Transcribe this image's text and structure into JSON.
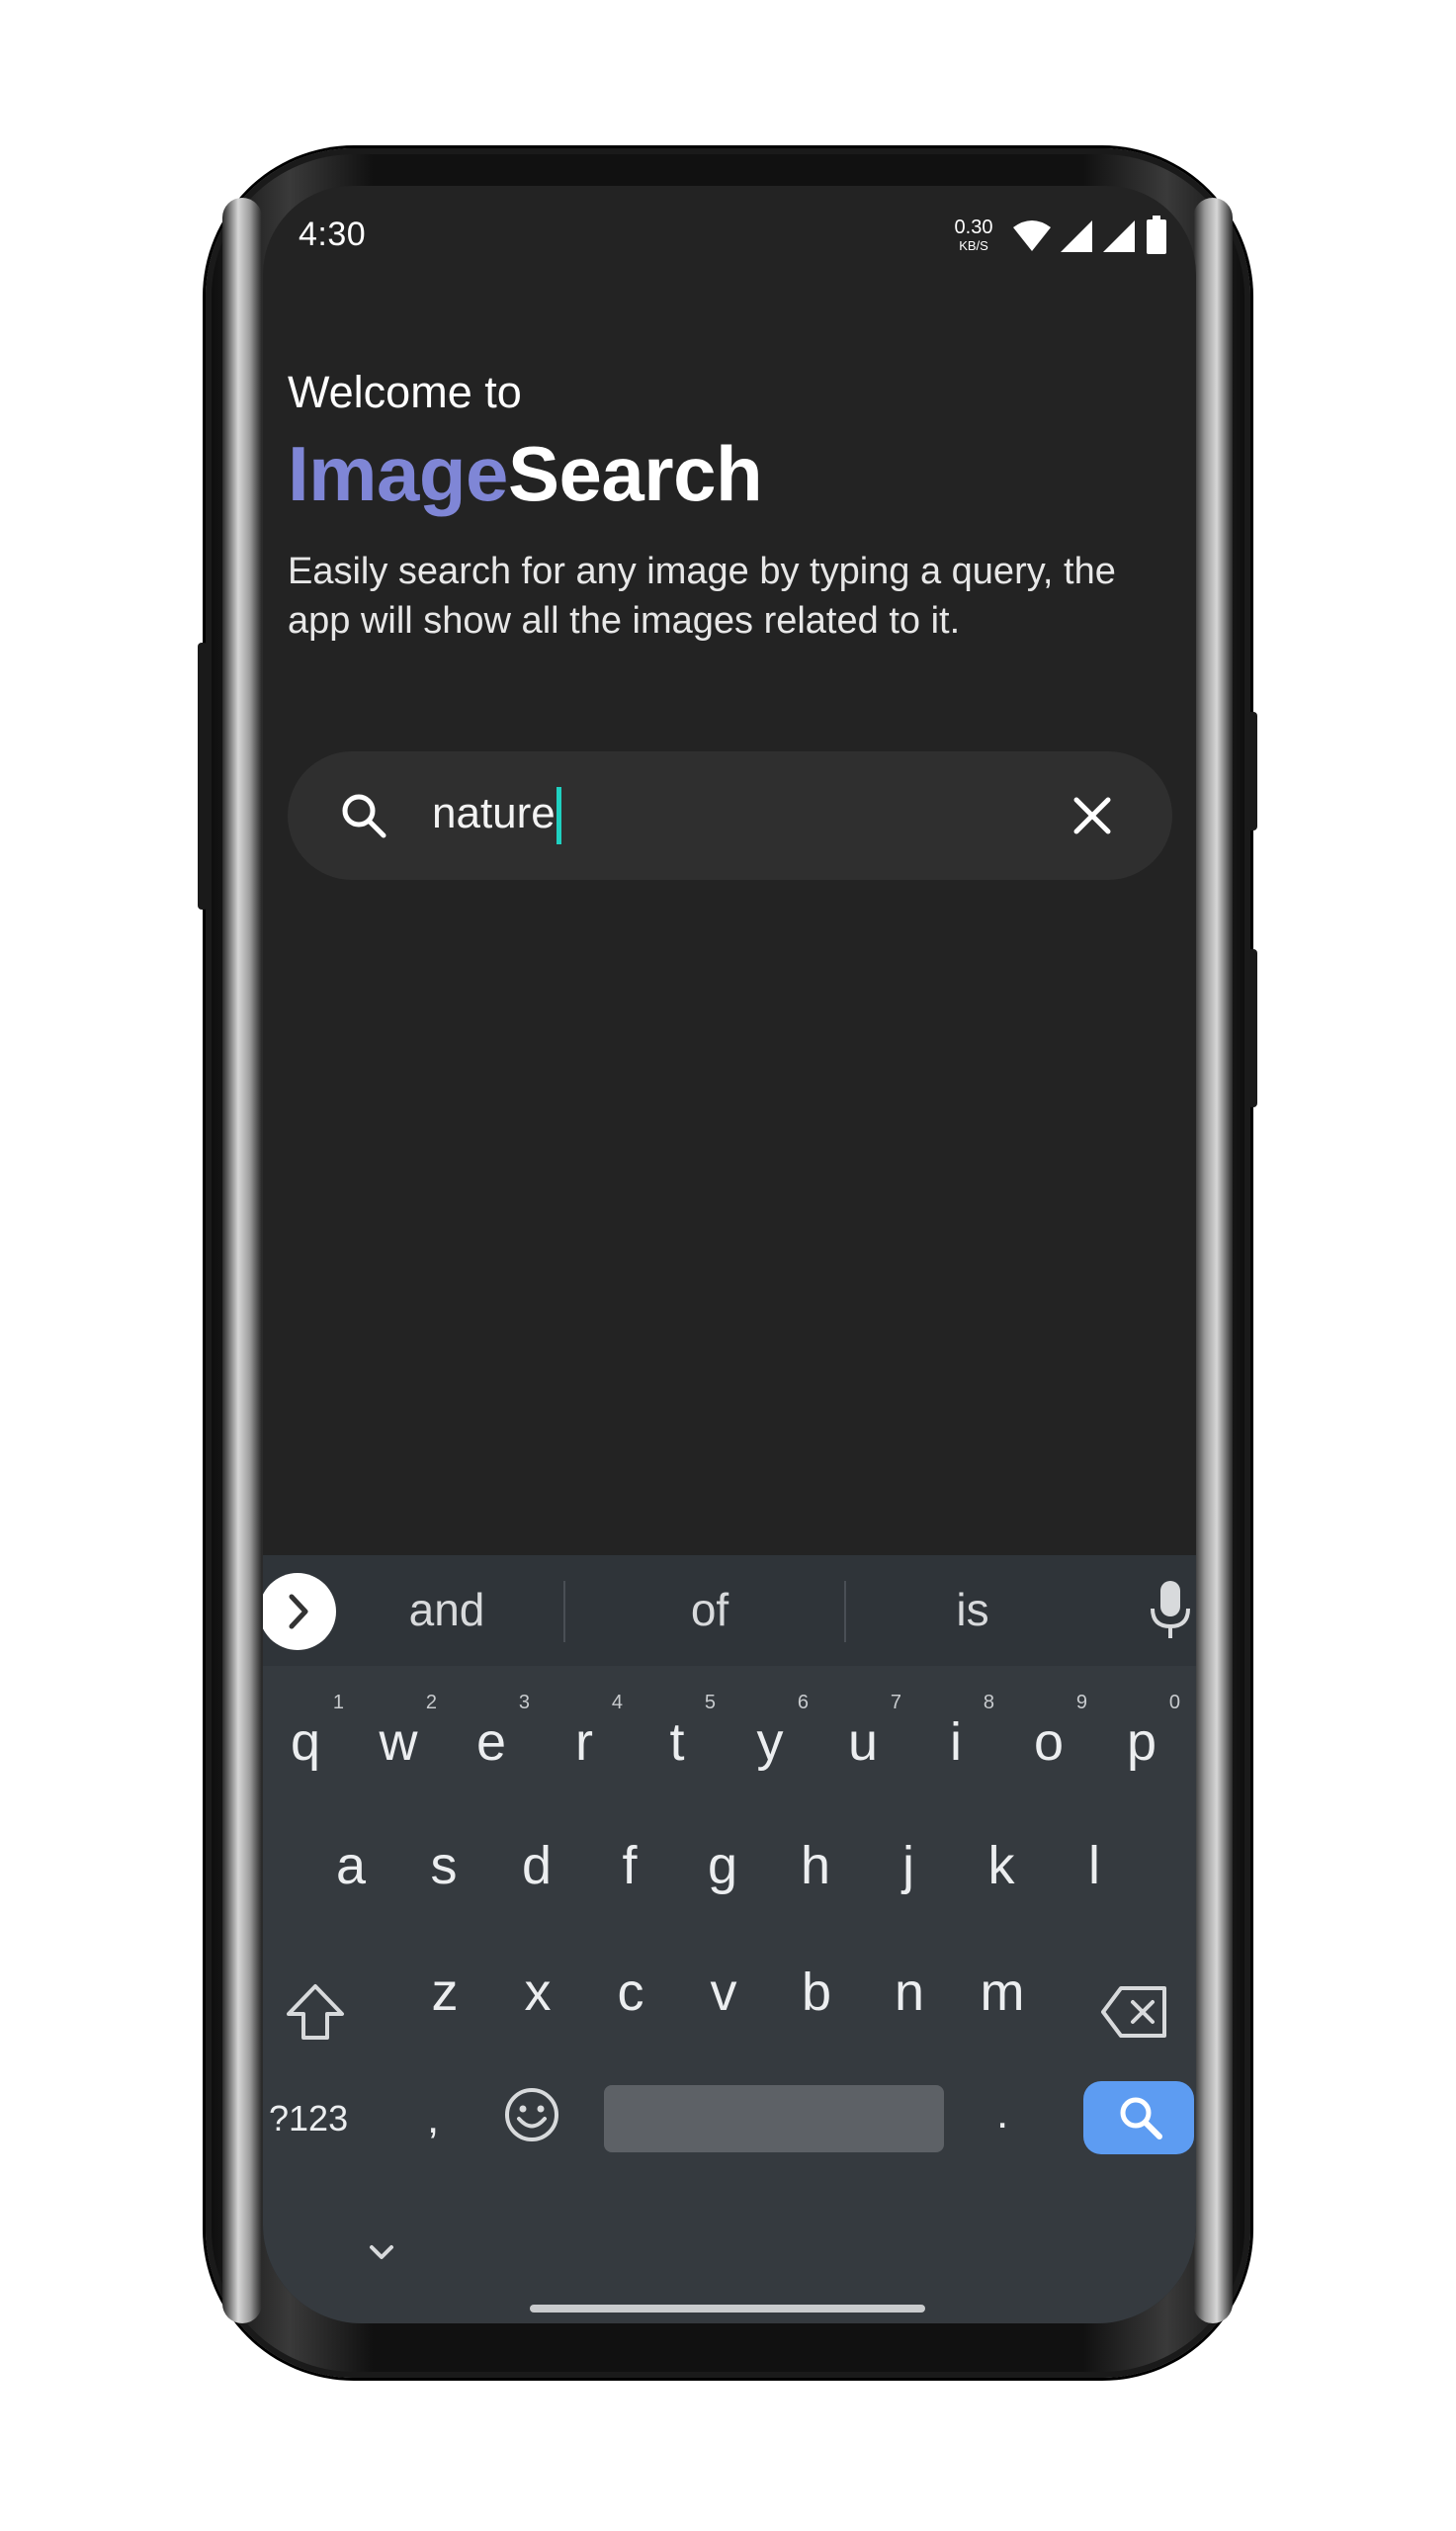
{
  "status_bar": {
    "time": "4:30",
    "net_speed_value": "0.30",
    "net_speed_unit": "KB/S",
    "icons": [
      "wifi-icon",
      "signal-icon",
      "signal-icon",
      "battery-icon"
    ]
  },
  "header": {
    "welcome": "Welcome to",
    "title_accent": "Image",
    "title_main": "Search",
    "description": "Easily search for any image by typing a query, the app will show all the images related to it."
  },
  "search": {
    "value": "nature",
    "icon": "search-icon",
    "clear_icon": "close-icon"
  },
  "keyboard": {
    "suggestions": [
      "and",
      "of",
      "is"
    ],
    "row1": [
      {
        "key": "q",
        "hint": "1"
      },
      {
        "key": "w",
        "hint": "2"
      },
      {
        "key": "e",
        "hint": "3"
      },
      {
        "key": "r",
        "hint": "4"
      },
      {
        "key": "t",
        "hint": "5"
      },
      {
        "key": "y",
        "hint": "6"
      },
      {
        "key": "u",
        "hint": "7"
      },
      {
        "key": "i",
        "hint": "8"
      },
      {
        "key": "o",
        "hint": "9"
      },
      {
        "key": "p",
        "hint": "0"
      }
    ],
    "row2": [
      "a",
      "s",
      "d",
      "f",
      "g",
      "h",
      "j",
      "k",
      "l"
    ],
    "row3": [
      "z",
      "x",
      "c",
      "v",
      "b",
      "n",
      "m"
    ],
    "symbols_label": "?123",
    "comma": ",",
    "period": "."
  },
  "colors": {
    "accent": "#7f86d6",
    "background": "#232323",
    "search_bar": "#2f2f2f",
    "caret": "#1fd1c1",
    "keyboard": "#353a3f",
    "enter_key": "#5d9cf2"
  }
}
